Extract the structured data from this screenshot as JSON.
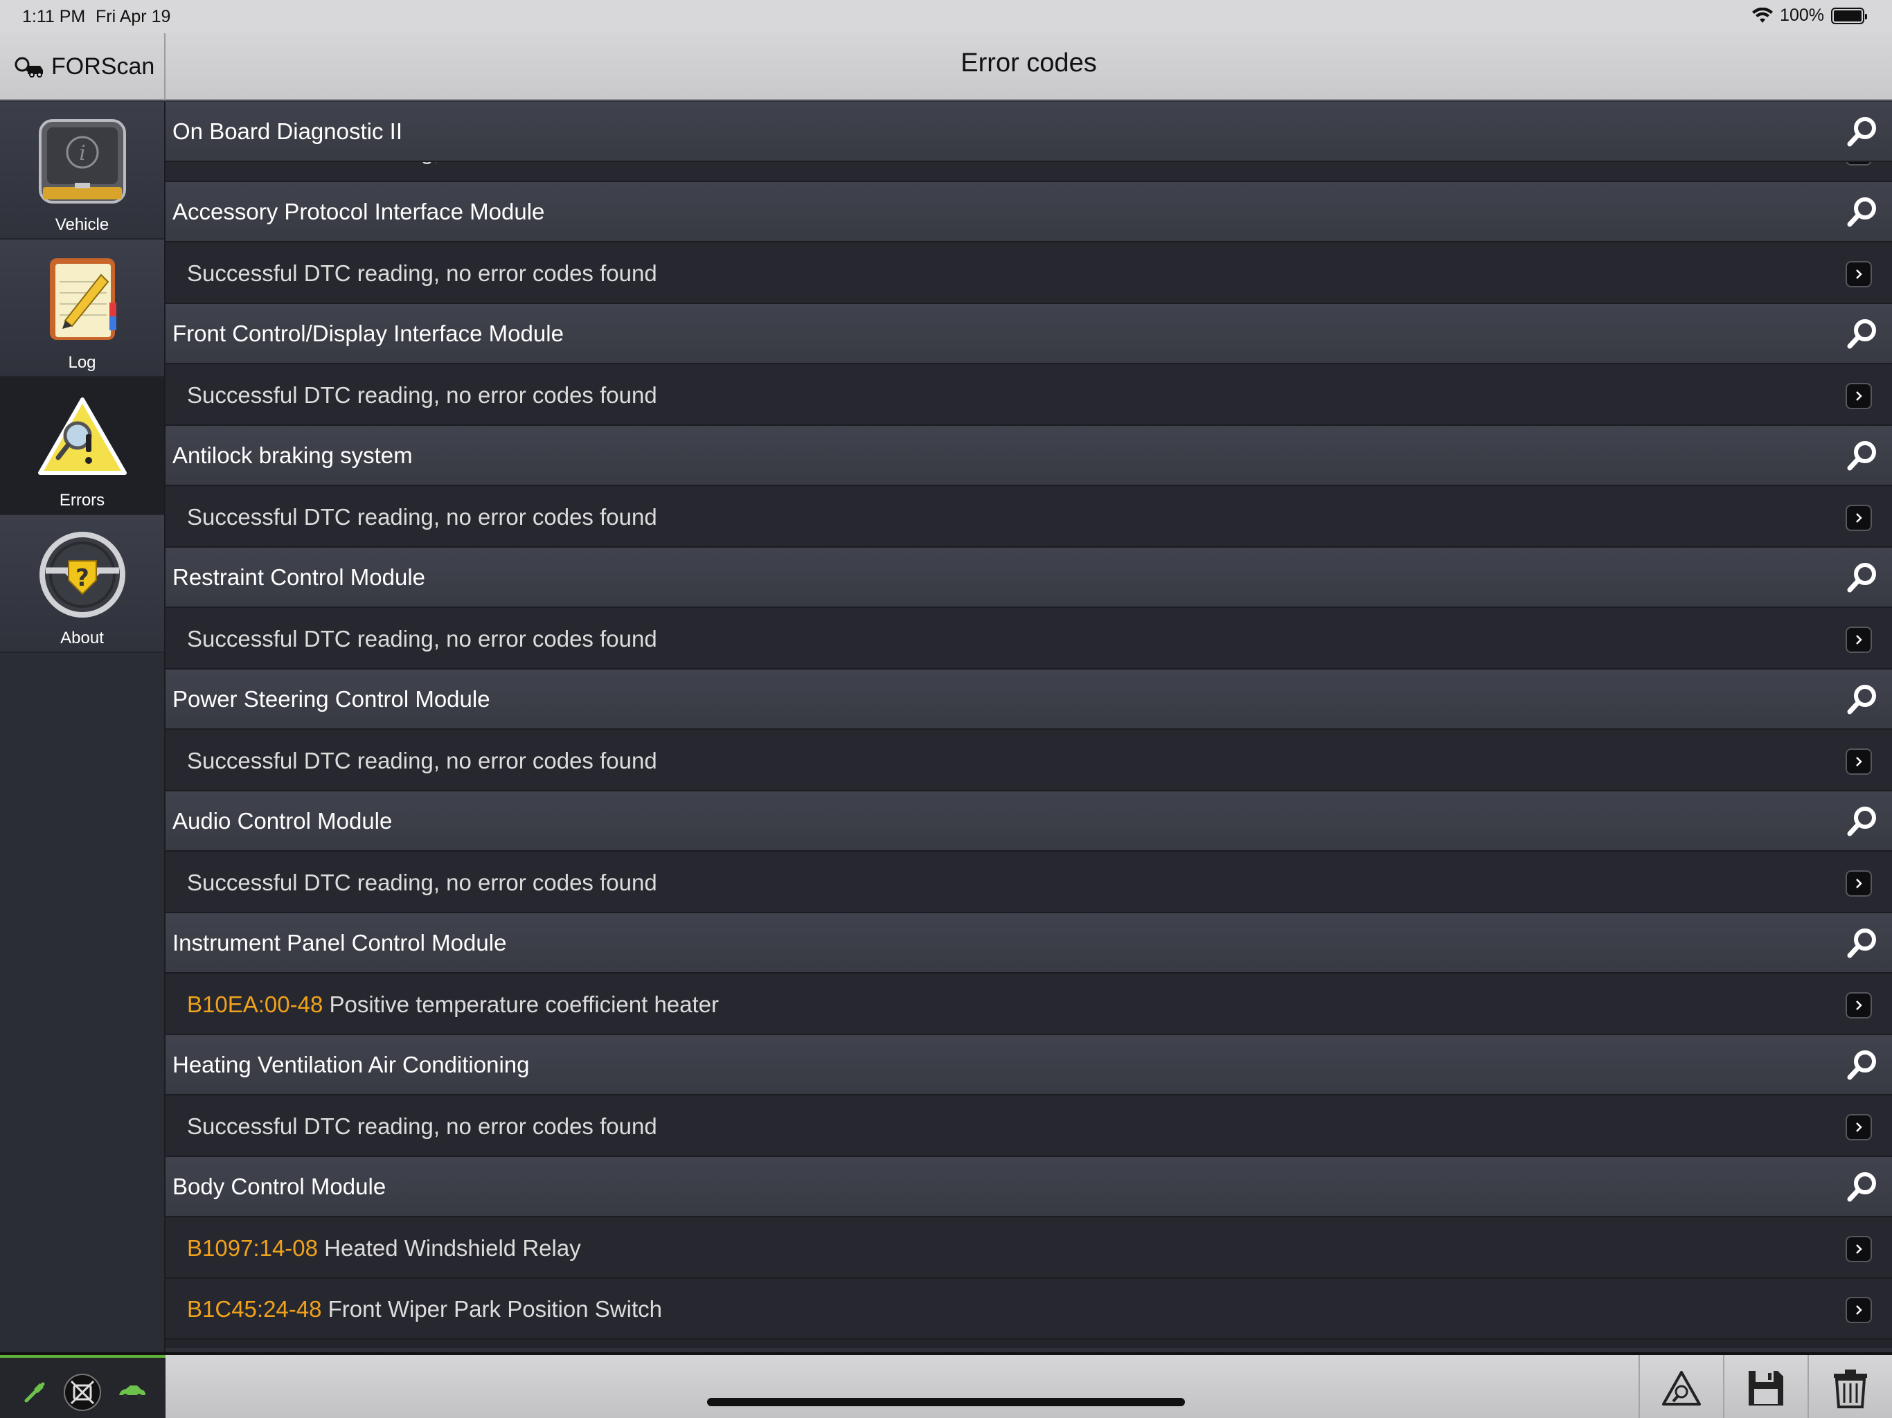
{
  "status_bar": {
    "time": "1:11 PM",
    "date": "Fri Apr 19",
    "battery": "100%"
  },
  "header": {
    "brand": "FORScan",
    "title": "Error codes"
  },
  "sidebar": {
    "items": [
      {
        "label": "Vehicle",
        "icon": "info-icon",
        "active": false
      },
      {
        "label": "Log",
        "icon": "notepad-pencil-icon",
        "active": false
      },
      {
        "label": "Errors",
        "icon": "warning-magnifier-icon",
        "active": true
      },
      {
        "label": "About",
        "icon": "steering-wheel-question-icon",
        "active": false
      }
    ]
  },
  "list": {
    "partial_top_text": "Successful DTC reading, no error codes found",
    "rows": [
      {
        "type": "module",
        "name": "On Board Diagnostic II"
      },
      {
        "type": "module",
        "name": "Accessory Protocol Interface Module"
      },
      {
        "type": "detail",
        "code": "",
        "text": "Successful DTC reading, no error codes found"
      },
      {
        "type": "module",
        "name": "Front Control/Display Interface Module"
      },
      {
        "type": "detail",
        "code": "",
        "text": "Successful DTC reading, no error codes found"
      },
      {
        "type": "module",
        "name": "Antilock braking system"
      },
      {
        "type": "detail",
        "code": "",
        "text": "Successful DTC reading, no error codes found"
      },
      {
        "type": "module",
        "name": "Restraint Control Module"
      },
      {
        "type": "detail",
        "code": "",
        "text": "Successful DTC reading, no error codes found"
      },
      {
        "type": "module",
        "name": "Power Steering Control Module"
      },
      {
        "type": "detail",
        "code": "",
        "text": "Successful DTC reading, no error codes found"
      },
      {
        "type": "module",
        "name": "Audio Control Module"
      },
      {
        "type": "detail",
        "code": "",
        "text": "Successful DTC reading, no error codes found"
      },
      {
        "type": "module",
        "name": "Instrument Panel Control Module"
      },
      {
        "type": "detail",
        "code": "B10EA:00-48",
        "text": " Positive temperature coefficient heater"
      },
      {
        "type": "module",
        "name": "Heating Ventilation Air Conditioning"
      },
      {
        "type": "detail",
        "code": "",
        "text": "Successful DTC reading, no error codes found"
      },
      {
        "type": "module",
        "name": "Body Control Module"
      },
      {
        "type": "detail",
        "code": "B1097:14-08",
        "text": " Heated Windshield Relay"
      },
      {
        "type": "detail",
        "code": "B1C45:24-48",
        "text": " Front Wiper Park Position Switch"
      }
    ]
  },
  "toolbar": {
    "connection_icons": [
      "plug-connected-icon",
      "adapter-disabled-icon",
      "car-icon"
    ],
    "buttons": [
      "clear-dtc-icon",
      "save-icon",
      "trash-icon"
    ]
  },
  "colors": {
    "dtc_code": "#f0a21b",
    "connection_ok": "#5fb23a"
  }
}
